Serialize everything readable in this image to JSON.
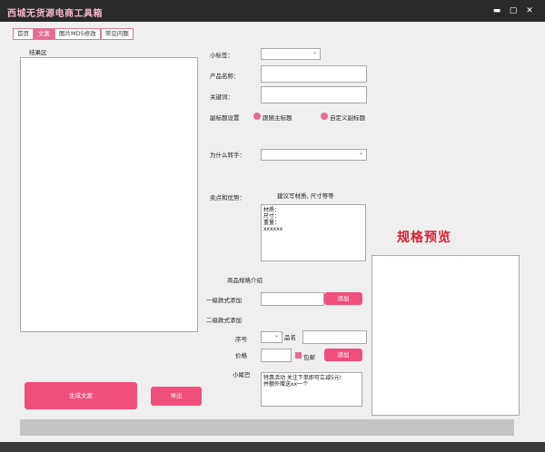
{
  "window": {
    "title": "西城无货源电商工具箱",
    "btn_min": "▬",
    "btn_max": "▢",
    "btn_close": "✕"
  },
  "tabs": [
    "首页",
    "文案",
    "图片MD5修改",
    "常见问题"
  ],
  "result": {
    "label": "结果区"
  },
  "fields": {
    "small_tag": "小标签：",
    "product_name": "产品名称：",
    "keywords": "关键词：",
    "subtitle_setting": "副标题设置",
    "subtitle_opt1": "跟随主标题",
    "subtitle_opt2": "自定义副标题",
    "why_transfer": "为什么转手：",
    "selling_points": "卖点和优势：",
    "selling_hint": "建议写材质, 尺寸等等",
    "selling_text": "材质：\n尺寸：\n重量：\nxxxxxx",
    "spec_intro": "商品规格介绍",
    "level1_add": "一级款式添加",
    "level2_add": "二级款式添加",
    "serial": "序号",
    "item_name": "品名",
    "price": "价格",
    "shipping": "包邮",
    "tail": "小尾巴",
    "tail_text": "特惠活动 关注下单即可立减5元!\n并额外赠送xx一个"
  },
  "buttons": {
    "add1": "添加",
    "add2": "添加",
    "generate": "生成文案",
    "export": "导出"
  },
  "preview": {
    "title": "规格预览"
  }
}
